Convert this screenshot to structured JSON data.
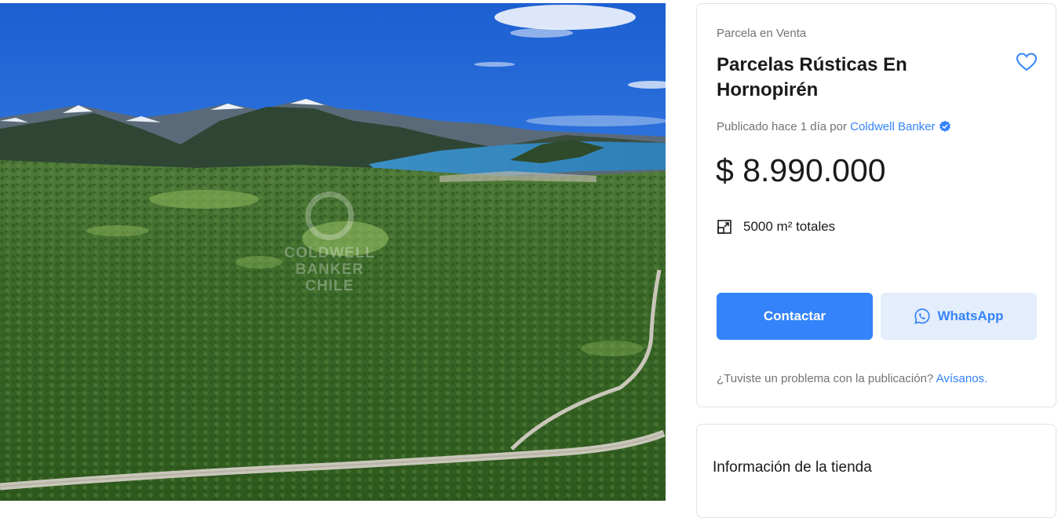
{
  "photo": {
    "alt_icon": "landscape-photo",
    "watermark": {
      "line1": "COLDWELL",
      "line2": "BANKER",
      "line3": "CHILE"
    }
  },
  "listing": {
    "condition": "Parcela en Venta",
    "title": "Parcelas Rústicas En Hornopirén",
    "favorite_icon": "heart-icon",
    "published_prefix": "Publicado hace 1 día por",
    "seller_name": "Coldwell Banker",
    "verified_icon": "verified-badge-icon",
    "price": "$ 8.990.000",
    "area_icon": "area-expand-icon",
    "area_text": "5000 m² totales",
    "contact_label": "Contactar",
    "whatsapp_label": "WhatsApp",
    "whatsapp_icon": "whatsapp-icon",
    "report_question": "¿Tuviste un problema con la publicación?",
    "report_link": "Avísanos.",
    "accent_color": "#3483fa"
  },
  "store": {
    "title": "Información de la tienda"
  }
}
